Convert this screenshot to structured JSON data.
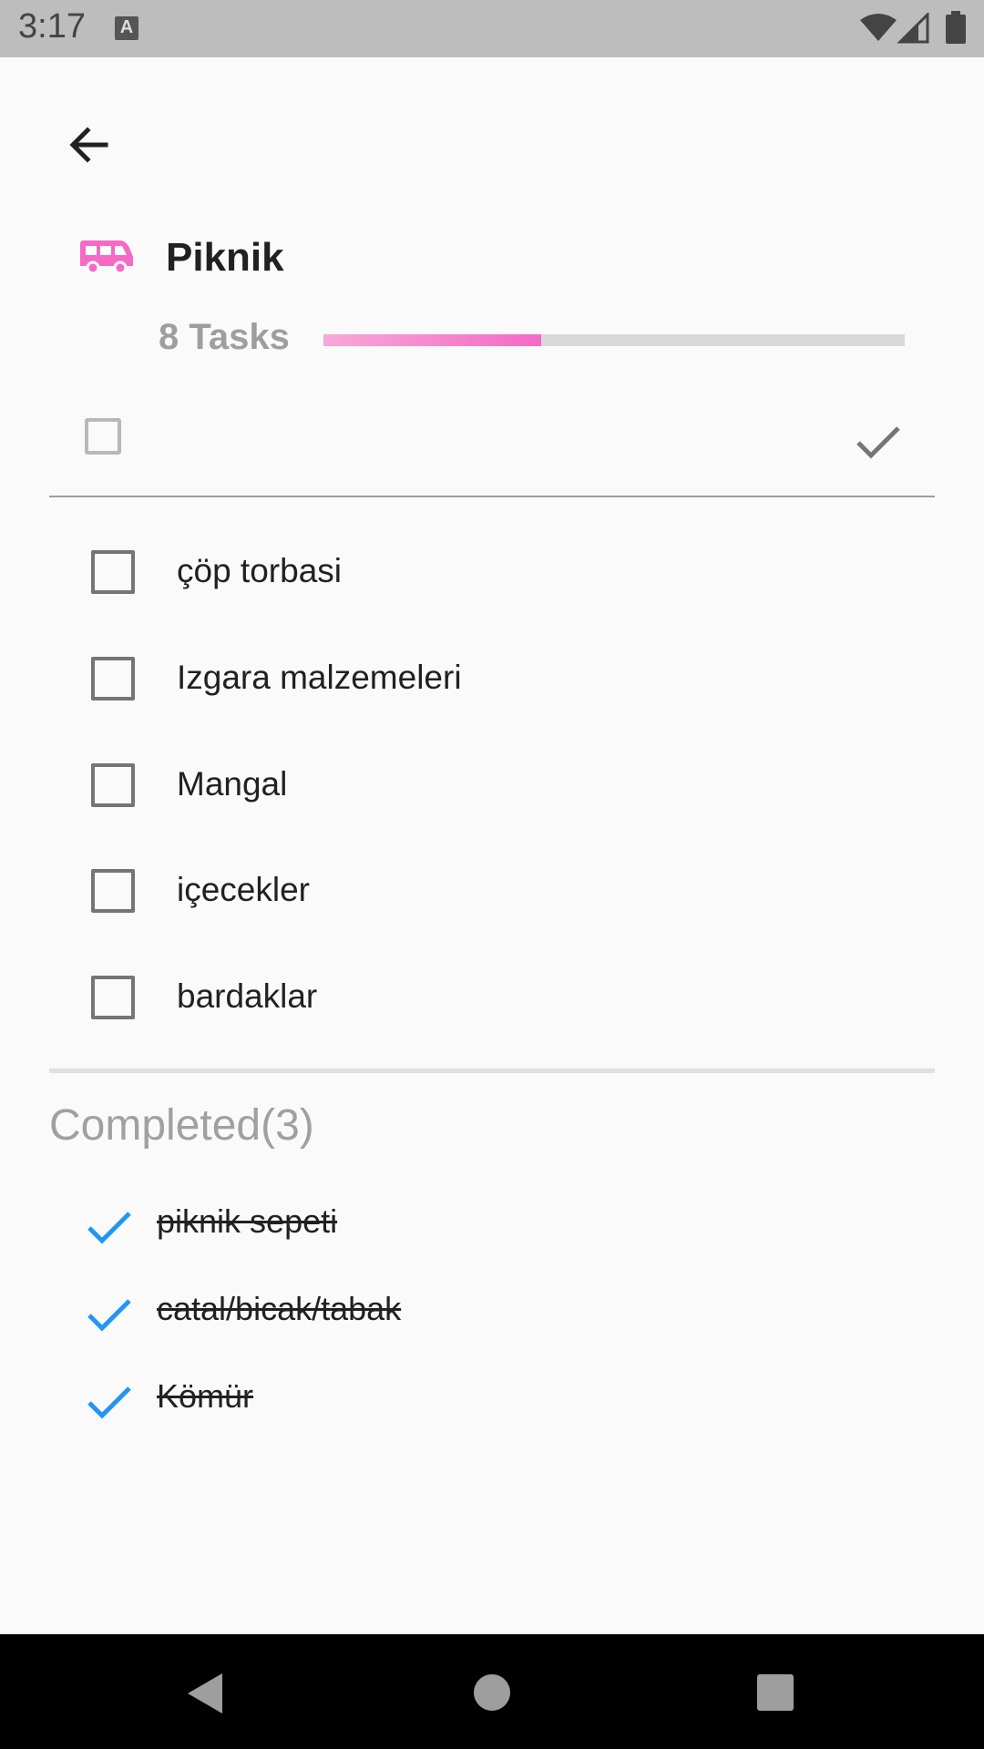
{
  "status_bar": {
    "time": "3:17",
    "notification_icon": "A"
  },
  "header": {
    "back_icon": "arrow-left-icon",
    "list_icon": "bus-icon",
    "list_title": "Piknik",
    "task_count": "8 Tasks",
    "progress": 0.375,
    "accent_color": "#f46ac4"
  },
  "new_task": {
    "placeholder": "",
    "value": ""
  },
  "tasks": [
    {
      "label": "çöp torbasi"
    },
    {
      "label": "Izgara malzemeleri"
    },
    {
      "label": "Mangal"
    },
    {
      "label": "içecekler"
    },
    {
      "label": "bardaklar"
    }
  ],
  "completed": {
    "header": "Completed(3)",
    "check_color": "#2196f3",
    "items": [
      {
        "label": "piknik sepeti"
      },
      {
        "label": "catal/bicak/tabak"
      },
      {
        "label": "Kömür"
      }
    ]
  }
}
